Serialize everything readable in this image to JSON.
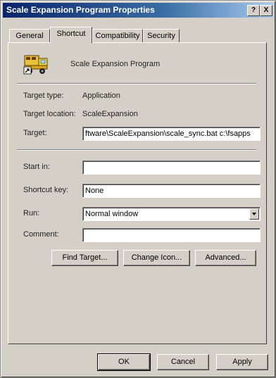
{
  "window": {
    "title": "Scale Expansion Program Properties"
  },
  "titlebar_buttons": {
    "help": "?",
    "close": "X"
  },
  "tabs": [
    {
      "label": "General"
    },
    {
      "label": "Shortcut"
    },
    {
      "label": "Compatibility"
    },
    {
      "label": "Security"
    }
  ],
  "active_tab": "Shortcut",
  "app": {
    "name": "Scale Expansion Program",
    "icon": "scale-truck-icon"
  },
  "info": {
    "target_type_label": "Target type:",
    "target_type_value": "Application",
    "target_location_label": "Target location:",
    "target_location_value": "ScaleExpansion"
  },
  "target": {
    "label": "Target:",
    "value": "ftware\\ScaleExpansion\\scale_sync.bat c:\\fsapps"
  },
  "start_in": {
    "label": "Start in:",
    "value": ""
  },
  "shortcut_key": {
    "label": "Shortcut key:",
    "value": "None"
  },
  "run": {
    "label": "Run:",
    "value": "Normal window"
  },
  "comment": {
    "label": "Comment:",
    "value": ""
  },
  "buttons": {
    "find_target": "Find Target...",
    "change_icon": "Change Icon...",
    "advanced": "Advanced...",
    "ok": "OK",
    "cancel": "Cancel",
    "apply": "Apply"
  }
}
